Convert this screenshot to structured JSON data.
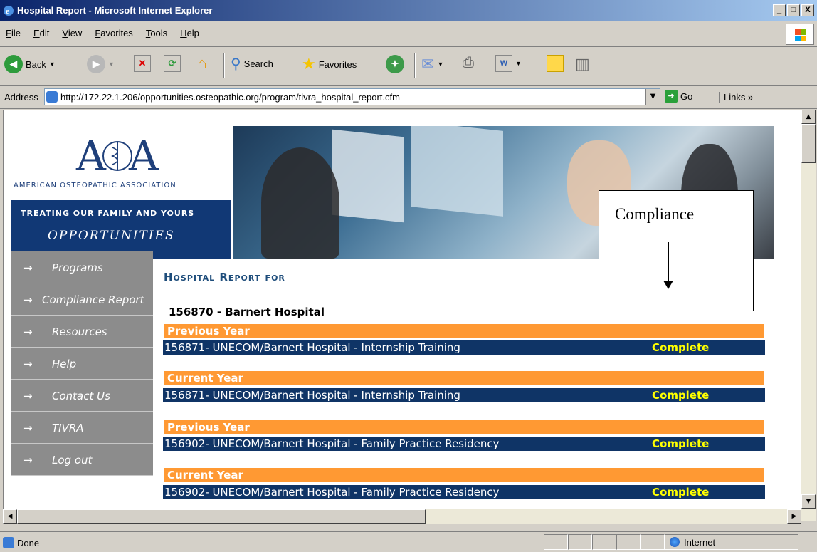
{
  "window": {
    "title": "Hospital Report - Microsoft Internet Explorer",
    "btn_min": "_",
    "btn_max": "□",
    "btn_close": "X"
  },
  "menu": [
    "File",
    "Edit",
    "View",
    "Favorites",
    "Tools",
    "Help"
  ],
  "toolbar": {
    "back": "Back",
    "search": "Search",
    "favorites": "Favorites"
  },
  "address": {
    "label": "Address",
    "url": "http://172.22.1.206/opportunities.osteopathic.org/program/tivra_hospital_report.cfm",
    "go": "Go",
    "links": "Links »"
  },
  "logo": {
    "mark": "AOA",
    "org_name": "AMERICAN OSTEOPATHIC ASSOCIATION",
    "tagline": "TREATING OUR FAMILY AND YOURS",
    "section": "OPPORTUNITIES"
  },
  "nav": [
    {
      "arrow": "→",
      "label": "Programs"
    },
    {
      "arrow": "→",
      "label": "Compliance Report"
    },
    {
      "arrow": "→",
      "label": "Resources"
    },
    {
      "arrow": "→",
      "label": "Help"
    },
    {
      "arrow": "→",
      "label": "Contact Us"
    },
    {
      "arrow": "→",
      "label": "TIVRA"
    },
    {
      "arrow": "→",
      "label": "Log out"
    }
  ],
  "report": {
    "heading": "Hospital Report for",
    "hospital": "156870 - Barnert Hospital",
    "sections": [
      {
        "year": "Previous Year",
        "program": "156871- UNECOM/Barnert Hospital - Internship Training",
        "status": "Complete"
      },
      {
        "year": "Current Year",
        "program": "156871- UNECOM/Barnert Hospital - Internship Training",
        "status": "Complete"
      },
      {
        "year": "Previous Year",
        "program": "156902- UNECOM/Barnert Hospital - Family Practice Residency",
        "status": "Complete"
      },
      {
        "year": "Current Year",
        "program": "156902- UNECOM/Barnert Hospital - Family Practice Residency",
        "status": "Complete"
      }
    ]
  },
  "callout": {
    "text": "Compliance"
  },
  "statusbar": {
    "left": "Done",
    "zone": "Internet"
  },
  "colors": {
    "nav_bg": "#8c8c8c",
    "year_bar": "#ff9933",
    "program_bar": "#0f3466",
    "status_text": "#ffff00",
    "logo_blue": "#113875"
  }
}
